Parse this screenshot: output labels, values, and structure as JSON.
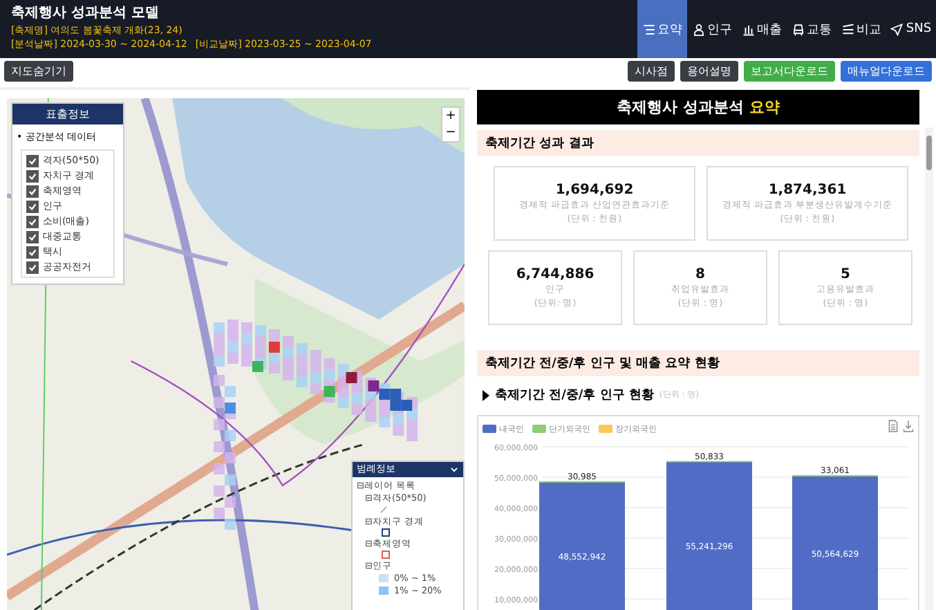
{
  "header": {
    "title": "축제행사 성과분석 모델",
    "festival": "[축제명] 여의도 봄꽃축제 개화(23, 24)",
    "analysis_dates": "[분석날짜] 2024-03-30 ~ 2024-04-12",
    "compare_dates": "[비교날짜] 2023-03-25 ~ 2023-04-07"
  },
  "nav": [
    {
      "label": "요약",
      "selected": true
    },
    {
      "label": "인구",
      "selected": false
    },
    {
      "label": "매출",
      "selected": false
    },
    {
      "label": "교통",
      "selected": false
    },
    {
      "label": "비교",
      "selected": false
    },
    {
      "label": "SNS",
      "selected": false
    }
  ],
  "toolbar": {
    "left": [
      {
        "label": "지도숨기기",
        "color": "#3a3d44"
      }
    ],
    "right": [
      {
        "label": "시사점",
        "color": "#3a3d44"
      },
      {
        "label": "용어설명",
        "color": "#3a3d44"
      },
      {
        "label": "보고서다운로드",
        "color": "#3fae49"
      },
      {
        "label": "매뉴얼다운로드",
        "color": "#3470d8"
      }
    ]
  },
  "map": {
    "zoom_in": "+",
    "zoom_out": "−",
    "layer_panel": {
      "title": "표출정보",
      "group": "• 공간분석 데이터",
      "layers": [
        {
          "label": "격자(50*50)",
          "checked": true
        },
        {
          "label": "자치구 경계",
          "checked": true
        },
        {
          "label": "축제영역",
          "checked": true
        },
        {
          "label": "인구",
          "checked": true
        },
        {
          "label": "소비(매출)",
          "checked": true
        },
        {
          "label": "대중교통",
          "checked": true
        },
        {
          "label": "택시",
          "checked": true
        },
        {
          "label": "공공자전거",
          "checked": true
        }
      ]
    },
    "legend": {
      "title": "범례정보",
      "expanded": true,
      "tree": [
        {
          "label": "⊟레이어 목록",
          "children": [
            {
              "label": "⊟격자(50*50)",
              "kind": "line"
            },
            {
              "label": "⊟자치구 경계",
              "kind": "square",
              "color": "#1f3f7a"
            },
            {
              "label": "⊟축제영역",
              "kind": "square",
              "color": "#e05a5a"
            },
            {
              "label": "⊟인구",
              "kind": "scale",
              "children": [
                {
                  "label": "0% ~ 1%",
                  "color": "#c6e2fb"
                },
                {
                  "label": "1% ~ 20%",
                  "color": "#8fc4f3"
                }
              ]
            }
          ]
        }
      ]
    }
  },
  "summary": {
    "title": "축제행사 성과분석",
    "title_highlight": "요약",
    "section1": "축제기간 성과 결과",
    "stat_rows": [
      [
        {
          "value": "1,694,692",
          "label": "경제적 파급효과 산업연관효과기준",
          "unit": "(단위 : 천원)"
        },
        {
          "value": "1,874,361",
          "label": "경제적 파급효과 부분생산유발계수기준",
          "unit": "(단위 : 천원)"
        }
      ],
      [
        {
          "value": "6,744,886",
          "label": "인구",
          "unit": "(단위: 명)"
        },
        {
          "value": "8",
          "label": "취업유발효과",
          "unit": "(단위 : 명)"
        },
        {
          "value": "5",
          "label": "고용유발효과",
          "unit": "(단위 : 명)"
        }
      ]
    ],
    "section2": "축제기간 전/중/후 인구 및 매출 요약 현황",
    "subsection": "축제기간 전/중/후 인구 현황",
    "subsection_unit": "(단위 : 명)",
    "chart_data": {
      "type": "bar",
      "stacked": true,
      "data_labels": true,
      "grid": true,
      "ylim": [
        0,
        60000000
      ],
      "yticks": [
        {
          "value": 10000000,
          "label": "10,000,000"
        },
        {
          "value": 20000000,
          "label": "20,000,000"
        },
        {
          "value": 30000000,
          "label": "30,000,000"
        },
        {
          "value": 40000000,
          "label": "40,000,000"
        },
        {
          "value": 50000000,
          "label": "50,000,000"
        },
        {
          "value": 60000000,
          "label": "60,000,000"
        }
      ],
      "series": [
        {
          "name": "내국인",
          "color": "#516cc4",
          "values": [
            48552942,
            55241296,
            50564629
          ],
          "value_labels": [
            "48,552,942",
            "55,241,296",
            "50,564,629"
          ]
        },
        {
          "name": "단기외국인",
          "color": "#91cc75",
          "values": [
            30985,
            50833,
            33061
          ],
          "value_labels": [
            "30,985",
            "50,833",
            "33,061"
          ]
        },
        {
          "name": "장기외국인",
          "color": "#fac858",
          "values": [
            null,
            null,
            null
          ]
        }
      ]
    }
  }
}
